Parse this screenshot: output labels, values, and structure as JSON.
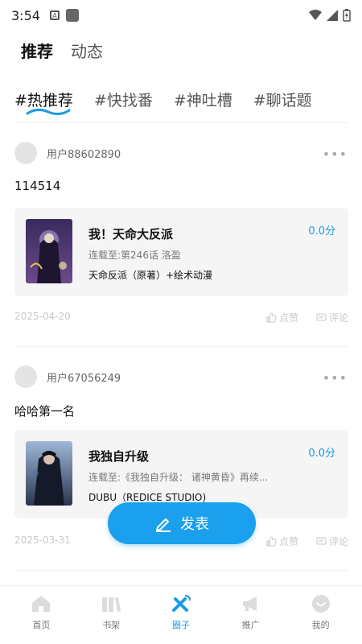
{
  "status_bar": {
    "time": "3:54"
  },
  "top_tabs": [
    {
      "label": "推荐",
      "active": true
    },
    {
      "label": "动态",
      "active": false
    }
  ],
  "topic_tabs": [
    {
      "label": "#热推荐",
      "active": true
    },
    {
      "label": "#快找番",
      "active": false
    },
    {
      "label": "#神吐槽",
      "active": false
    },
    {
      "label": "#聊话题",
      "active": false
    }
  ],
  "posts": [
    {
      "username": "用户88602890",
      "text": "114514",
      "card": {
        "title": "我！天命大反派",
        "score": "0.0分",
        "progress": "连载至:第246话 洛盈",
        "author": "天命反派（原著）+绘术动漫"
      },
      "date": "2025-04-20",
      "like_label": "点赞",
      "comment_label": "评论"
    },
    {
      "username": "用户67056249",
      "text": "哈哈第一名",
      "card": {
        "title": "我独自升级",
        "score": "0.0分",
        "progress": "连载至:《我独自升级： 诸神黄昏》再续...",
        "author": "DUBU（REDICE STUDIO)"
      },
      "date": "2025-03-31",
      "like_label": "点赞",
      "comment_label": "评论"
    }
  ],
  "fab": {
    "label": "发表",
    "icon": "pencil-icon"
  },
  "bottom_nav": [
    {
      "label": "首页",
      "icon": "home-icon",
      "active": false
    },
    {
      "label": "书架",
      "icon": "bookshelf-icon",
      "active": false
    },
    {
      "label": "圈子",
      "icon": "circle-icon",
      "active": true
    },
    {
      "label": "推广",
      "icon": "megaphone-icon",
      "active": false
    },
    {
      "label": "我的",
      "icon": "profile-icon",
      "active": false
    }
  ],
  "colors": {
    "accent": "#1a9be8",
    "card_bg": "#f5f5f5",
    "meta": "#c8c8c8"
  }
}
